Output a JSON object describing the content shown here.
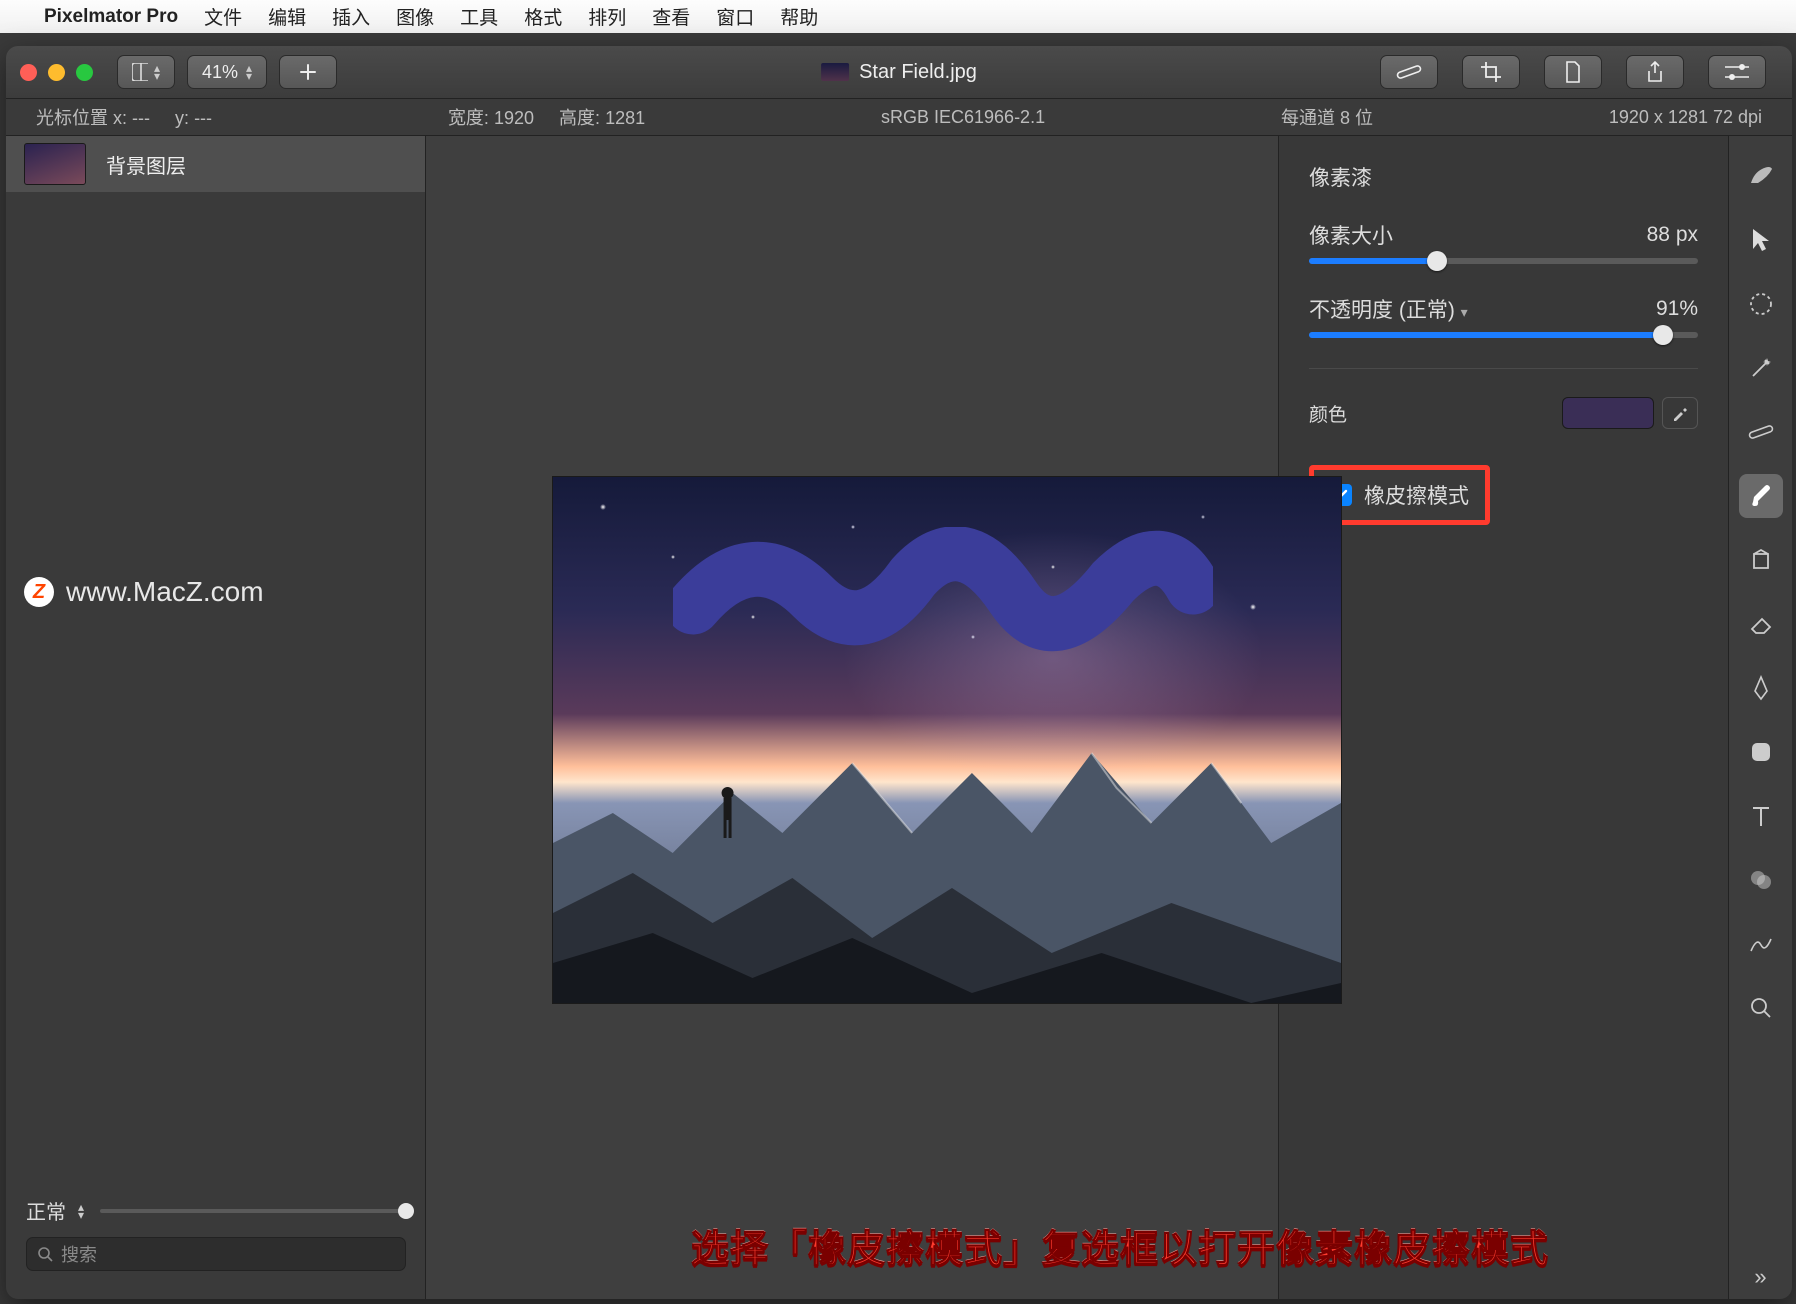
{
  "menubar": {
    "appname": "Pixelmator Pro",
    "items": [
      "文件",
      "编辑",
      "插入",
      "图像",
      "工具",
      "格式",
      "排列",
      "查看",
      "窗口",
      "帮助"
    ]
  },
  "titlebar": {
    "zoom": "41%",
    "filename": "Star Field.jpg"
  },
  "infobar": {
    "cursor_label": "光标位置 x:",
    "cursor_x": "---",
    "cursor_y_label": "y:",
    "cursor_y": "---",
    "width_label": "宽度:",
    "width": "1920",
    "height_label": "高度:",
    "height": "1281",
    "colorspace": "sRGB IEC61966-2.1",
    "depth": "每通道 8 位",
    "dims": "1920 x 1281 72 dpi"
  },
  "layers": {
    "items": [
      {
        "name": "背景图层"
      }
    ]
  },
  "watermark": "www.MacZ.com",
  "props": {
    "title": "像素漆",
    "size_label": "像素大小",
    "size_value": "88 px",
    "size_pct": 33,
    "opacity_label": "不透明度 (正常)",
    "opacity_value": "91%",
    "opacity_pct": 91,
    "color_label": "颜色",
    "swatch_color": "#3a2e56",
    "eraser_label": "橡皮擦模式",
    "eraser_checked": true
  },
  "bottom": {
    "blend": "正常",
    "search_placeholder": "搜索"
  },
  "tools": [
    "brush-picker-icon",
    "arrow-icon",
    "marquee-icon",
    "magic-wand-icon",
    "repair-icon",
    "paint-icon",
    "fill-icon",
    "eraser-icon",
    "pen-icon",
    "shape-icon",
    "text-icon",
    "color-icon",
    "effects-icon",
    "zoom-icon",
    "more-icon"
  ],
  "caption": "选择「橡皮擦模式」复选框以打开像素橡皮擦模式"
}
